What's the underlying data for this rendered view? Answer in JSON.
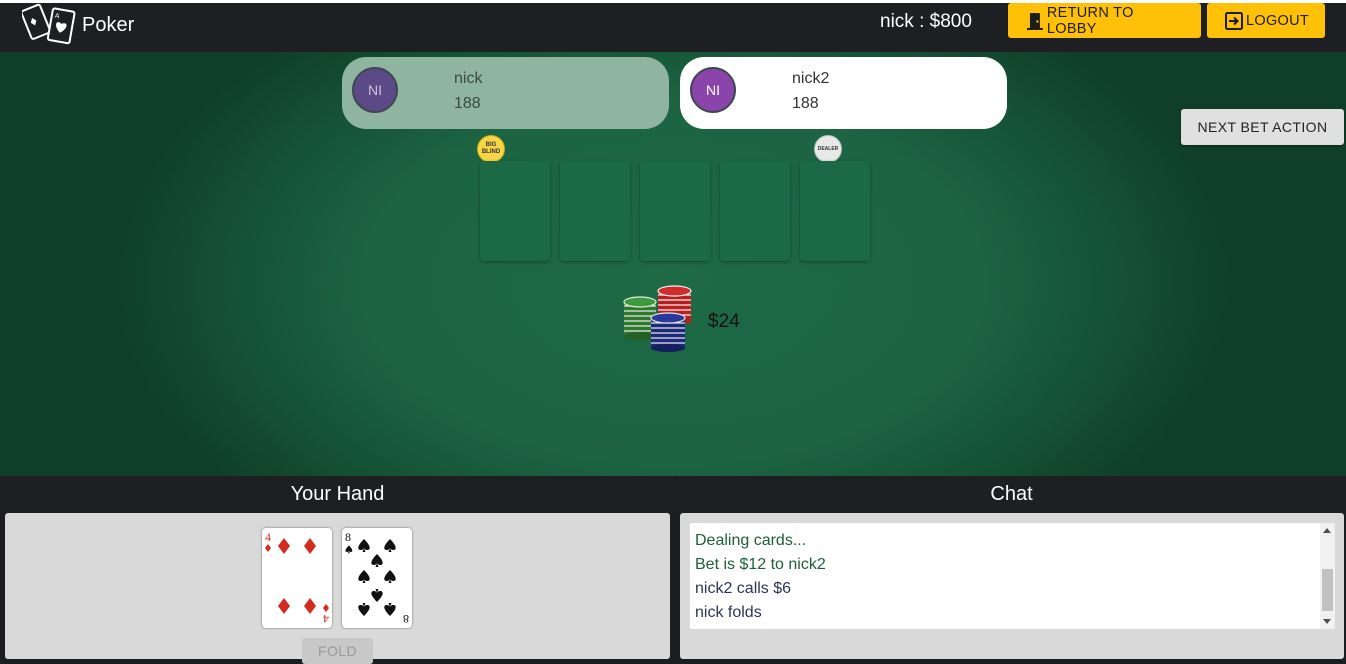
{
  "app": {
    "title": "Poker"
  },
  "header": {
    "balance": "nick : $800",
    "return_to_lobby": "RETURN TO LOBBY",
    "logout": "LOGOUT",
    "icons": {
      "logo": "playing-cards-logo-icon",
      "lobby": "door-icon",
      "logout": "exit-icon"
    }
  },
  "table": {
    "players": [
      {
        "initials": "NI",
        "name": "nick",
        "chips": "188",
        "state": "folded"
      },
      {
        "initials": "NI",
        "name": "nick2",
        "chips": "188",
        "state": "active"
      }
    ],
    "markers": {
      "big_blind": "BIG BLIND",
      "dealer": "DEALER"
    },
    "community_cards": [],
    "pot": "$24",
    "next_bet_action": "NEXT BET ACTION"
  },
  "hand": {
    "title": "Your Hand",
    "cards": [
      {
        "rank": "4",
        "suit": "diamonds"
      },
      {
        "rank": "8",
        "suit": "spades"
      }
    ],
    "fold": "FOLD"
  },
  "chat": {
    "title": "Chat",
    "messages": [
      {
        "text": "Dealing cards...",
        "color": "#1e5e3c"
      },
      {
        "text": "Bet is $12 to nick2",
        "color": "#1e5e3c"
      },
      {
        "text": "nick2 calls $6",
        "color": "#2b3557"
      },
      {
        "text": "nick folds",
        "color": "#2b3557"
      }
    ]
  },
  "colors": {
    "accent": "#ffc107",
    "felt": "#1d6a45",
    "navbar": "#1d1f23"
  }
}
